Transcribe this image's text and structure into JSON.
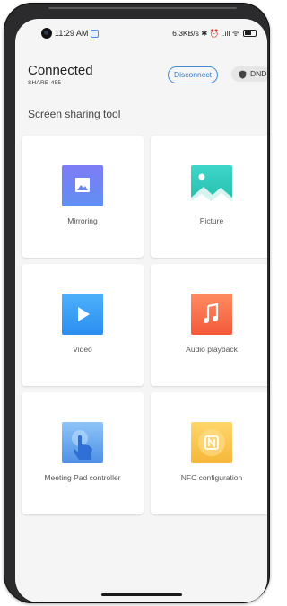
{
  "status_bar": {
    "time": "11:29 AM",
    "right_text": "6.3KB/s ✱ ⏰ ᵢ.ıll ᯤ"
  },
  "header": {
    "title": "Connected",
    "subtitle": "SHARE-455",
    "disconnect_label": "Disconnect",
    "dnd_label": "DND"
  },
  "section_title": "Screen sharing tool",
  "tools": [
    {
      "label": "Mirroring",
      "icon": "mirroring-icon"
    },
    {
      "label": "Picture",
      "icon": "picture-icon"
    },
    {
      "label": "Video",
      "icon": "video-icon"
    },
    {
      "label": "Audio playback",
      "icon": "audio-icon"
    },
    {
      "label": "Meeting Pad controller",
      "icon": "touch-hand-icon"
    },
    {
      "label": "NFC configuration",
      "icon": "nfc-icon"
    }
  ],
  "colors": {
    "accent": "#3d8bd9",
    "background": "#f5f5f5",
    "tile": "#ffffff"
  }
}
